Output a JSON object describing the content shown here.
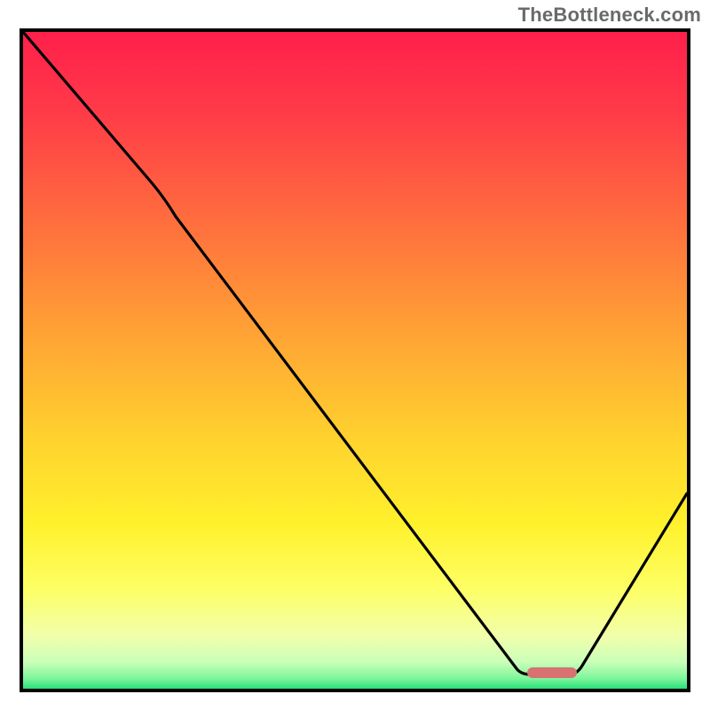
{
  "watermark": "TheBottleneck.com",
  "chart_data": {
    "type": "line",
    "title": "",
    "xlabel": "",
    "ylabel": "",
    "xlim": [
      0,
      100
    ],
    "ylim": [
      0,
      100
    ],
    "x": [
      0,
      19,
      23,
      74,
      77,
      82,
      84,
      100
    ],
    "values": [
      100,
      77,
      72,
      3,
      2,
      2,
      3.5,
      30
    ],
    "optimal_range_x": [
      76,
      83
    ],
    "gradient_stops": [
      {
        "pos": 0.0,
        "color": "#ff1f4b"
      },
      {
        "pos": 0.12,
        "color": "#ff3a48"
      },
      {
        "pos": 0.28,
        "color": "#ff6b3e"
      },
      {
        "pos": 0.45,
        "color": "#ffa035"
      },
      {
        "pos": 0.62,
        "color": "#ffd22e"
      },
      {
        "pos": 0.75,
        "color": "#fff12c"
      },
      {
        "pos": 0.85,
        "color": "#fdff66"
      },
      {
        "pos": 0.92,
        "color": "#f1ffab"
      },
      {
        "pos": 0.96,
        "color": "#c9ffb8"
      },
      {
        "pos": 0.985,
        "color": "#7bf59a"
      },
      {
        "pos": 1.0,
        "color": "#28e07a"
      }
    ],
    "marker_color": "#d87171"
  }
}
